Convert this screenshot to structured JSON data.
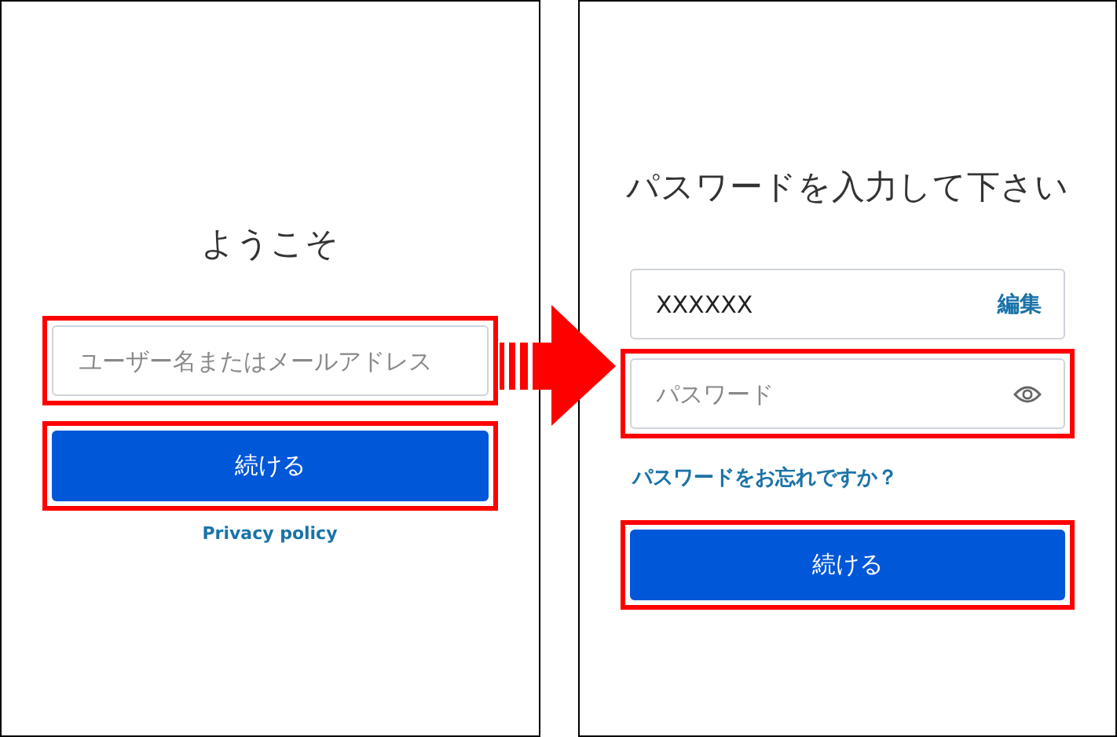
{
  "panels": [
    {
      "title": "ようこそ",
      "items": [
        {
          "kind": "text_field",
          "placeholder": "ユーザー名またはメールアドレス",
          "highlighted": true
        },
        {
          "kind": "button",
          "label": "続ける",
          "highlighted": true
        },
        {
          "kind": "footer_link",
          "label": "Privacy policy",
          "highlighted": false
        }
      ]
    },
    {
      "title": "パスワードを入力して下さい",
      "items": [
        {
          "kind": "text_field",
          "value": "XXXXXX",
          "action": "編集",
          "highlighted": false
        },
        {
          "kind": "password_field",
          "placeholder": "パスワード",
          "highlighted": true
        },
        {
          "kind": "link",
          "label": "パスワードをお忘れですか？",
          "highlighted": false
        },
        {
          "kind": "button",
          "label": "続ける",
          "highlighted": true
        }
      ]
    }
  ]
}
